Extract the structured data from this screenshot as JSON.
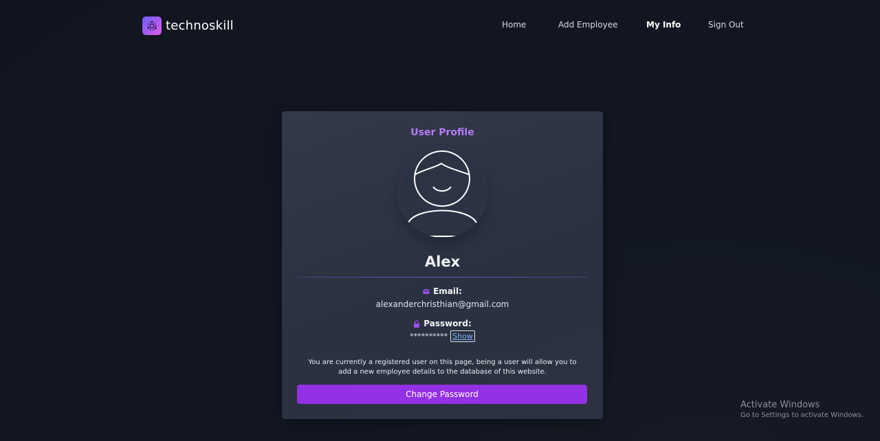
{
  "brand": {
    "name": "technoskill",
    "logo_icon": "brand-logo-icon"
  },
  "nav": {
    "items": [
      {
        "label": "Home",
        "active": false
      },
      {
        "label": "Add Employee",
        "active": false
      },
      {
        "label": "My Info",
        "active": true
      },
      {
        "label": "Sign Out",
        "active": false
      }
    ]
  },
  "profile": {
    "title": "User Profile",
    "avatar_icon": "user-avatar-icon",
    "name": "Alex",
    "email_label": "Email:",
    "email_icon": "envelope-icon",
    "email": "alexanderchristhian@gmail.com",
    "password_label": "Password:",
    "password_icon": "lock-icon",
    "password_masked": "**********",
    "show_label": "Show",
    "info_text": "You are currently a registered user on this page, being a user will allow you to add a new employee details to the database of this website.",
    "change_password_label": "Change Password"
  },
  "colors": {
    "accent": "#9331e6",
    "title": "#b67cf5",
    "background": "#121622",
    "card": "#2c3342"
  },
  "system_watermark": {
    "title": "Activate Windows",
    "subtitle": "Go to Settings to activate Windows."
  }
}
